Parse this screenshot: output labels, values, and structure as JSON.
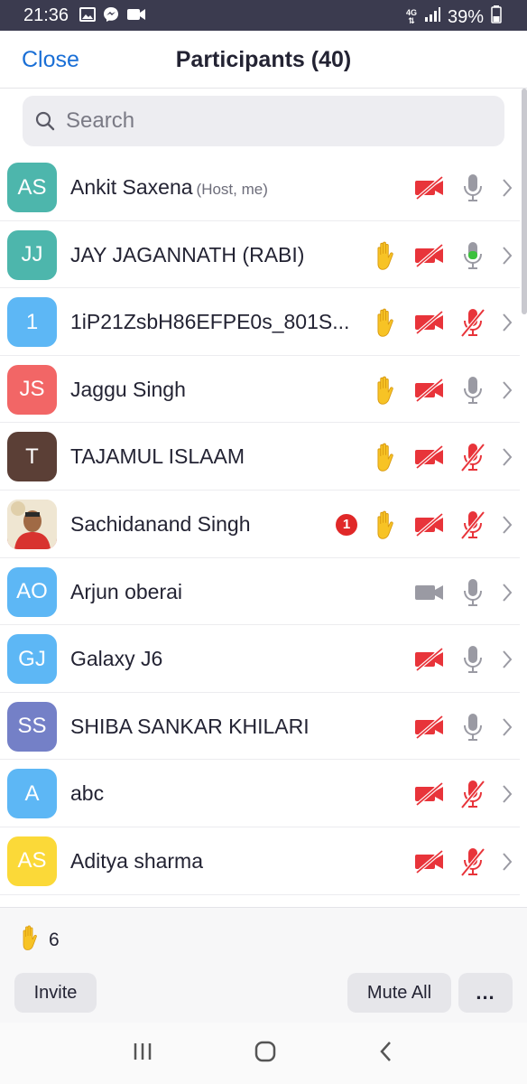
{
  "status_bar": {
    "time": "21:36",
    "network": "4G",
    "battery": "39%",
    "icons": [
      "gallery-icon",
      "messenger-icon",
      "video-icon",
      "signal-icon",
      "battery-icon"
    ]
  },
  "header": {
    "close_label": "Close",
    "title": "Participants (40)"
  },
  "search": {
    "placeholder": "Search"
  },
  "colors": {
    "accent": "#1a6fd6",
    "muted_red": "#e8343a",
    "active_green": "#3cc13c",
    "hand_yellow": "#f7c325"
  },
  "participants": [
    {
      "initials": "AS",
      "name": "Ankit Saxena",
      "role": "(Host, me)",
      "avatar_color": "#4db6ac",
      "hand_raised": false,
      "unread": "",
      "video": "off",
      "audio": "unmuted-gray"
    },
    {
      "initials": "JJ",
      "name": "JAY JAGANNATH (RABI)",
      "role": "",
      "avatar_color": "#4db6ac",
      "hand_raised": true,
      "unread": "",
      "video": "off",
      "audio": "unmuted-green"
    },
    {
      "initials": "1",
      "name": "1iP21ZsbH86EFPE0s_801S...",
      "role": "",
      "avatar_color": "#5db7f5",
      "hand_raised": true,
      "unread": "",
      "video": "off",
      "audio": "muted"
    },
    {
      "initials": "JS",
      "name": "Jaggu Singh",
      "role": "",
      "avatar_color": "#f26666",
      "hand_raised": true,
      "unread": "",
      "video": "off",
      "audio": "unmuted-gray"
    },
    {
      "initials": "T",
      "name": "TAJAMUL ISLAAM",
      "role": "",
      "avatar_color": "#5b3f36",
      "hand_raised": true,
      "unread": "",
      "video": "off",
      "audio": "muted"
    },
    {
      "initials": "",
      "name": "Sachidanand Singh",
      "role": "",
      "avatar_color": "photo",
      "hand_raised": true,
      "unread": "1",
      "video": "off",
      "audio": "muted"
    },
    {
      "initials": "AO",
      "name": "Arjun oberai",
      "role": "",
      "avatar_color": "#5db7f5",
      "hand_raised": false,
      "unread": "",
      "video": "on",
      "audio": "unmuted-gray"
    },
    {
      "initials": "GJ",
      "name": "Galaxy J6",
      "role": "",
      "avatar_color": "#5db7f5",
      "hand_raised": false,
      "unread": "",
      "video": "off",
      "audio": "unmuted-gray"
    },
    {
      "initials": "SS",
      "name": "SHIBA SANKAR KHILARI",
      "role": "",
      "avatar_color": "#7480c7",
      "hand_raised": false,
      "unread": "",
      "video": "off",
      "audio": "unmuted-gray"
    },
    {
      "initials": "A",
      "name": "abc",
      "role": "",
      "avatar_color": "#5db7f5",
      "hand_raised": false,
      "unread": "",
      "video": "off",
      "audio": "muted"
    },
    {
      "initials": "AS",
      "name": "Aditya sharma",
      "role": "",
      "avatar_color": "#fbd938",
      "hand_raised": false,
      "unread": "",
      "video": "off",
      "audio": "muted"
    }
  ],
  "footer": {
    "raised_hands_count": "6",
    "invite_label": "Invite",
    "mute_all_label": "Mute All",
    "more_label": "..."
  },
  "nav": {
    "icons": [
      "recents-icon",
      "home-icon",
      "back-icon"
    ]
  }
}
